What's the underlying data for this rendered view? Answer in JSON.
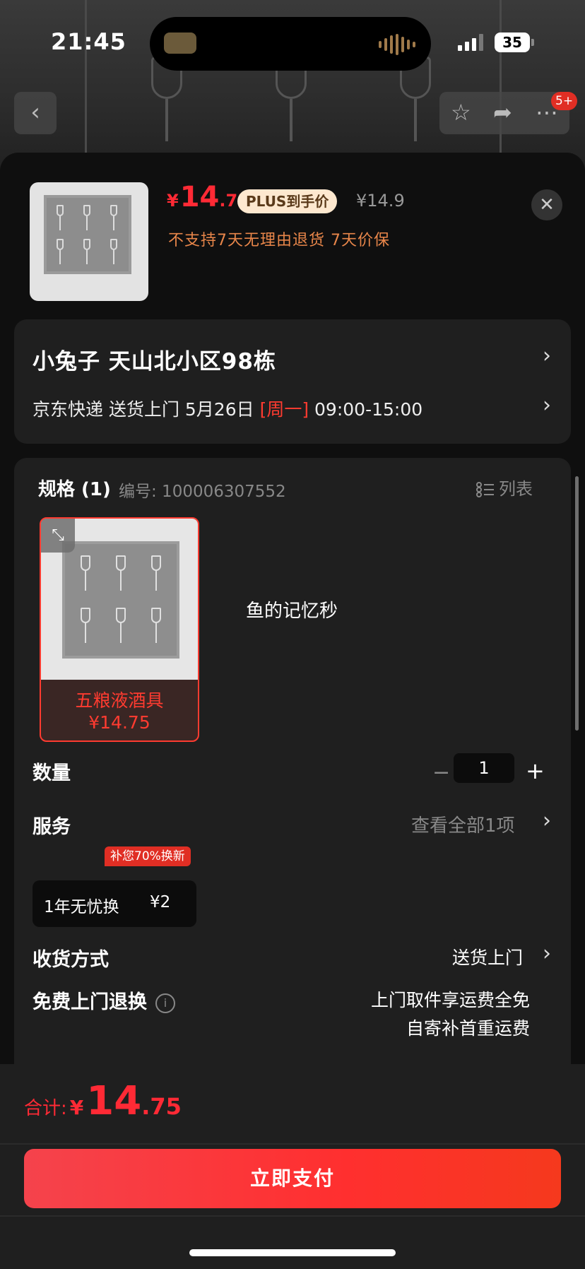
{
  "status_bar": {
    "time": "21:45",
    "battery": "35"
  },
  "nav": {
    "badge": "5+"
  },
  "product": {
    "price_symbol": "¥",
    "price_int": "14",
    "price_dec": ".75",
    "plus_tag": "PLUS到手价",
    "original_price": "¥14.9",
    "return_note": "不支持7天无理由退货  7天价保"
  },
  "address": {
    "line": "小兔子  天山北小区98栋",
    "delivery_prefix": "京东快递 送货上门 5月26日 ",
    "delivery_day": "[周一]",
    "delivery_time": " 09:00-15:00"
  },
  "spec": {
    "title": "规格 (1)",
    "code": "编号: 100006307552",
    "list_label": "列表",
    "option_name": "五粮液酒具",
    "option_price": "¥14.75",
    "side_note": "鱼的记忆秒"
  },
  "quantity": {
    "label": "数量",
    "value": "1",
    "minus": "−",
    "plus": "+"
  },
  "service": {
    "label": "服务",
    "view_all": "查看全部1项",
    "tag": "补您70%换新",
    "item_label": "1年无忧换",
    "item_price": "¥2"
  },
  "shipping": {
    "label": "收货方式",
    "value": "送货上门"
  },
  "free_return": {
    "label": "免费上门退换",
    "line1": "上门取件享运费全免",
    "line2": "自寄补首重运费"
  },
  "footer": {
    "total_label": "合计:",
    "total_symbol": "¥",
    "total_int": "14",
    "total_dec": ".75",
    "pay_label": "立即支付"
  },
  "colors": {
    "accent": "#ff2a35",
    "plus_tag_bg": "#fde8cf",
    "note_orange": "#e8864a",
    "sheet_bg": "#0f0f0f",
    "card_bg": "#1f1f1f"
  }
}
